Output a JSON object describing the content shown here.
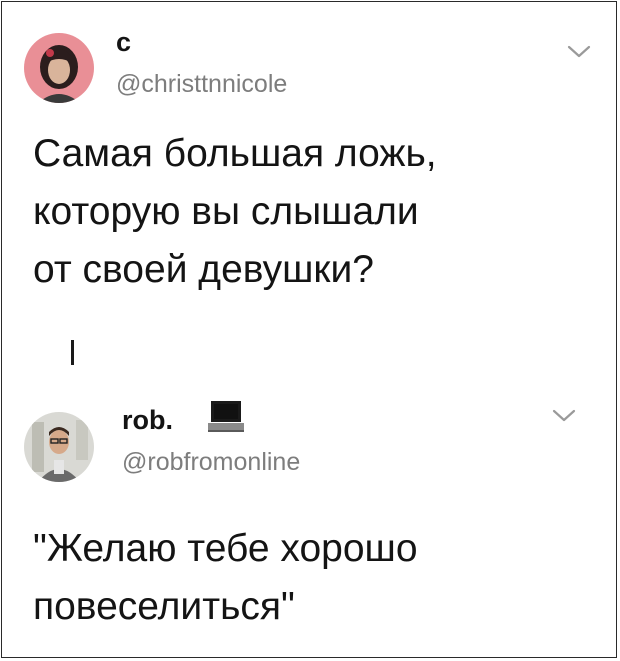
{
  "tweet1": {
    "display_name": "c",
    "handle": "@christtnnicole",
    "avatar_icon": "profile-photo-avatar",
    "menu_icon": "chevron-down-icon",
    "text_lines": [
      "Самая большая ложь,",
      "которую вы слышали",
      "от своей девушки?"
    ]
  },
  "tweet2": {
    "display_name": "rob.",
    "name_emoji_icon": "laptop-icon",
    "handle": "@robfromonline",
    "avatar_icon": "profile-photo-avatar",
    "menu_icon": "chevron-down-icon",
    "text_lines": [
      "\"Желаю тебе хорошо",
      "повеселиться\""
    ]
  },
  "colors": {
    "text": "#141414",
    "handle": "#7d7d7d",
    "avatar1_bg": "#e98f96",
    "avatar2_bg": "#d9d9d4"
  }
}
